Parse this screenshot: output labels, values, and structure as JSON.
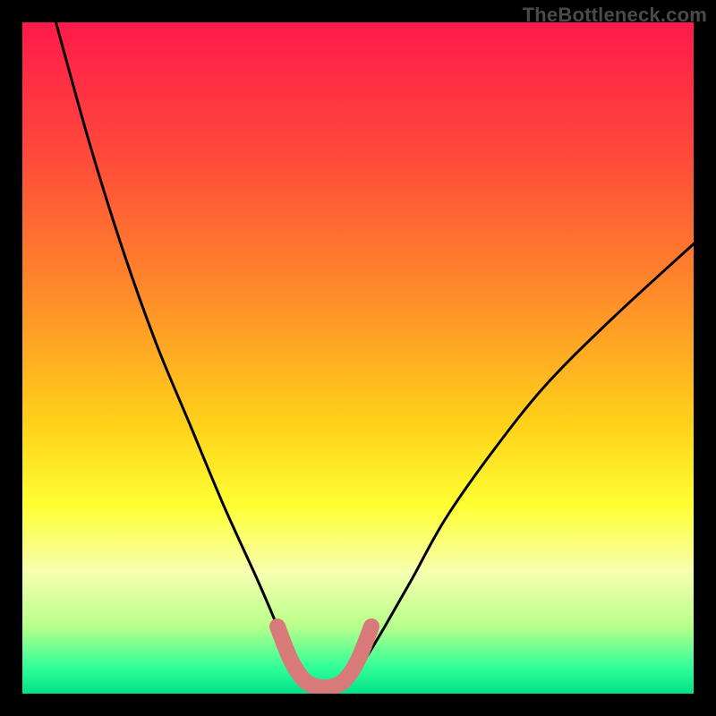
{
  "watermark": "TheBottleneck.com",
  "chart_data": {
    "type": "line",
    "title": "",
    "xlabel": "",
    "ylabel": "",
    "xlim": [
      0,
      100
    ],
    "ylim": [
      0,
      100
    ],
    "gradient_stops": [
      {
        "offset": 0,
        "color": "#ff1a4b"
      },
      {
        "offset": 20,
        "color": "#ff4a3a"
      },
      {
        "offset": 40,
        "color": "#ff8a2a"
      },
      {
        "offset": 60,
        "color": "#ffd21a"
      },
      {
        "offset": 72,
        "color": "#ffff33"
      },
      {
        "offset": 82,
        "color": "#f6ffb0"
      },
      {
        "offset": 90,
        "color": "#b8ff8a"
      },
      {
        "offset": 96,
        "color": "#33ff99"
      },
      {
        "offset": 100,
        "color": "#00e28a"
      }
    ],
    "series": [
      {
        "name": "left-branch",
        "x": [
          5,
          10,
          15,
          20,
          25,
          30,
          35,
          38,
          40,
          42
        ],
        "y": [
          100,
          82,
          66,
          52,
          40,
          28,
          17,
          10,
          5,
          2
        ]
      },
      {
        "name": "right-branch",
        "x": [
          49,
          51,
          54,
          58,
          63,
          70,
          78,
          88,
          100
        ],
        "y": [
          2,
          5,
          10,
          17,
          26,
          36,
          46,
          56,
          67
        ]
      },
      {
        "name": "bottom-highlight",
        "x": [
          38,
          40,
          42,
          44,
          46,
          48,
          50,
          52
        ],
        "y": [
          10,
          5,
          2,
          1,
          1,
          2,
          5,
          10
        ],
        "style": "thick-pink"
      }
    ]
  }
}
